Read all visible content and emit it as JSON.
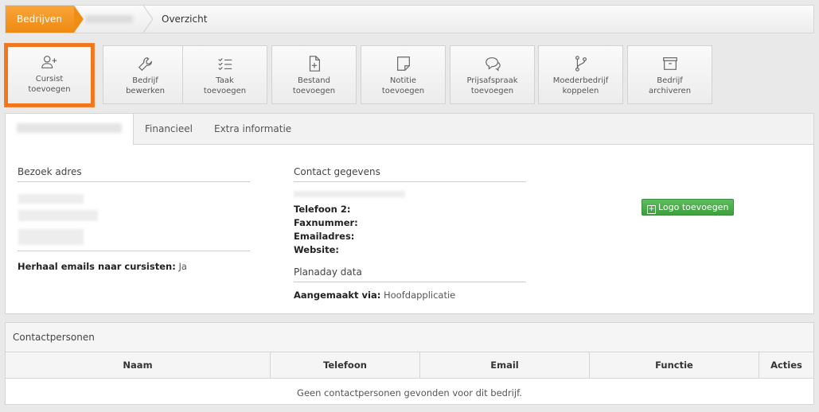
{
  "breadcrumb": {
    "home": "Bedrijven",
    "current": "Overzicht"
  },
  "toolbar": {
    "buttons": [
      {
        "line1": "Cursist",
        "line2": "toevoegen",
        "icon": "user-plus-icon"
      },
      {
        "line1": "Bedrijf",
        "line2": "bewerken",
        "icon": "wrench-icon"
      },
      {
        "line1": "Taak",
        "line2": "toevoegen",
        "icon": "task-list-icon"
      },
      {
        "line1": "Bestand",
        "line2": "toevoegen",
        "icon": "file-plus-icon"
      },
      {
        "line1": "Notitie",
        "line2": "toevoegen",
        "icon": "note-icon"
      },
      {
        "line1": "Prijsafspraak",
        "line2": "toevoegen",
        "icon": "chat-icon"
      },
      {
        "line1": "Moederbedrijf",
        "line2": "koppelen",
        "icon": "branch-icon"
      },
      {
        "line1": "Bedrijf",
        "line2": "archiveren",
        "icon": "archive-icon"
      }
    ]
  },
  "tabs": {
    "financial": "Financieel",
    "extra": "Extra informatie"
  },
  "address": {
    "title": "Bezoek adres",
    "repeat_label": "Herhaal emails naar cursisten:",
    "repeat_value": "Ja"
  },
  "contact": {
    "title": "Contact gegevens",
    "phone2": "Telefoon 2:",
    "fax": "Faxnummer:",
    "email": "Emailadres:",
    "website": "Website:"
  },
  "planaday": {
    "title": "Planaday data",
    "created_label": "Aangemaakt via:",
    "created_value": "Hoofdapplicatie"
  },
  "logo_button": "Logo toevoegen",
  "contacts": {
    "title": "Contactpersonen",
    "columns": [
      "Naam",
      "Telefoon",
      "Email",
      "Functie",
      "Acties"
    ],
    "empty": "Geen contactpersonen gevonden voor dit bedrijf."
  },
  "colors": {
    "accent": "#f2761d",
    "success": "#4cae4c"
  }
}
